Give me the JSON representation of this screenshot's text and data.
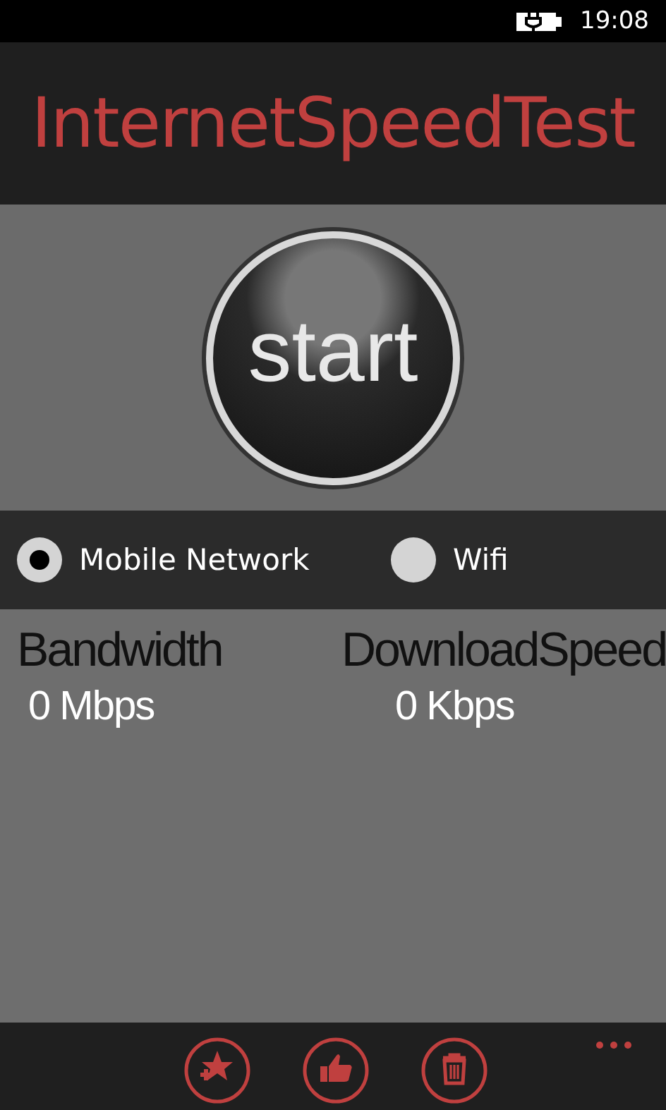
{
  "status_bar": {
    "time": "19:08"
  },
  "title": "InternetSpeedTest",
  "start_button": {
    "label": "start"
  },
  "network_options": [
    {
      "label": "Mobile Network",
      "selected": true
    },
    {
      "label": "Wifi",
      "selected": false
    }
  ],
  "stats": [
    {
      "label": "Bandwidth",
      "value": "0 Mbps"
    },
    {
      "label": "DownloadSpeed",
      "value": "0 Kbps"
    }
  ],
  "app_bar": {
    "buttons": [
      {
        "kind": "favorite"
      },
      {
        "kind": "like"
      },
      {
        "kind": "delete"
      }
    ]
  }
}
